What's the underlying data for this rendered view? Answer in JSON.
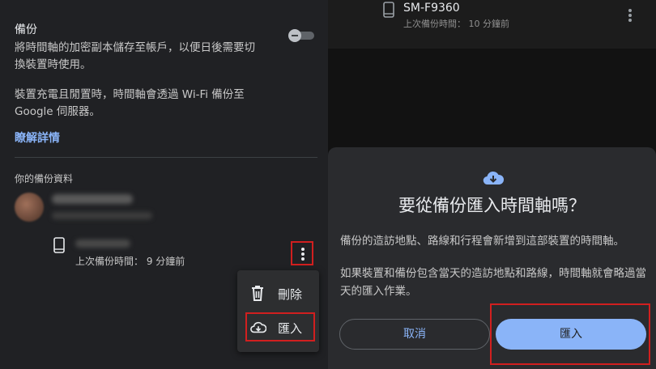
{
  "left": {
    "backup_title": "備份",
    "backup_desc": "將時間軸的加密副本儲存至帳戶，以便日後需要切換裝置時使用。",
    "backup_desc2": "裝置充電且閒置時，時間軸會透過 Wi-Fi 備份至 Google 伺服器。",
    "learn_more": "瞭解詳情",
    "toggle_state": "off",
    "your_backups": "你的備份資料",
    "last_backup": "上次備份時間： 9 分鐘前"
  },
  "menu": {
    "delete_label": "刪除",
    "import_label": "匯入"
  },
  "right": {
    "device_name": "SM-F9360",
    "last_backup": "上次備份時間： 10 分鐘前"
  },
  "dialog": {
    "title": "要從備份匯入時間軸嗎？",
    "p1": "備份的造訪地點、路線和行程會新增到這部裝置的時間軸。",
    "p2": "如果裝置和備份包含當天的造訪地點和路線，時間軸就會略過當天的匯入作業。",
    "cancel_label": "取消",
    "import_label": "匯入"
  },
  "colors": {
    "accent": "#8ab4f8",
    "highlight": "#d11f1f",
    "panel": "#2a2b2e"
  }
}
